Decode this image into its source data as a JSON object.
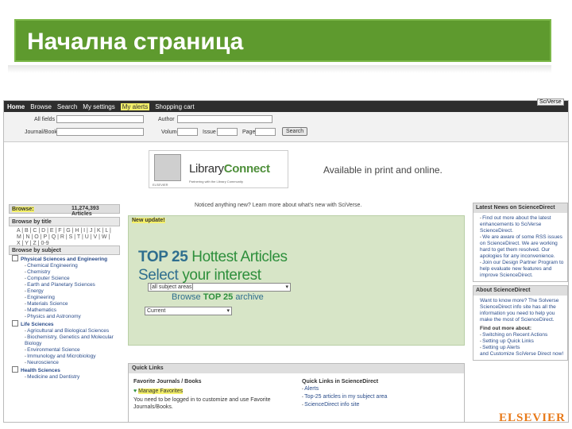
{
  "slide": {
    "title": "Начална страница"
  },
  "topnav": {
    "items": [
      "Home",
      "Browse",
      "Search",
      "My settings",
      "My alerts",
      "Shopping cart"
    ],
    "help": "Help"
  },
  "search": {
    "all_fields": "All fields",
    "journal_book_title": "Journal/Book title",
    "author": "Author",
    "volume": "Volume",
    "issue": "Issue",
    "page": "Page",
    "button": "Search"
  },
  "banner": {
    "brand_a": "Library",
    "brand_b": "Connect",
    "tagline": "Partnering with the Library Community",
    "elsevier": "ELSEVIER",
    "available": "Available in print and online."
  },
  "notice": "Noticed anything new? Learn more about what's new with SciVerse.",
  "left": {
    "browse_label": "Browse:",
    "browse_count": "11,274,393 Articles",
    "by_title": "Browse by title",
    "az": "A | B | C | D | E | F | G | H | I | J | K | L | M | N | O | P | Q | R | S | T | U | V | W | X | Y | Z | 0-9",
    "by_subject": "Browse by subject",
    "subjects": [
      {
        "cat": "Physical Sciences and Engineering",
        "items": [
          "Chemical Engineering",
          "Chemistry",
          "Computer Science",
          "Earth and Planetary Sciences",
          "Energy",
          "Engineering",
          "Materials Science",
          "Mathematics",
          "Physics and Astronomy"
        ]
      },
      {
        "cat": "Life Sciences",
        "items": [
          "Agricultural and Biological Sciences",
          "Biochemistry, Genetics and Molecular Biology",
          "Environmental Science",
          "Immunology and Microbiology",
          "Neuroscience"
        ]
      },
      {
        "cat": "Health Sciences",
        "items": [
          "Medicine and Dentistry"
        ]
      }
    ]
  },
  "center": {
    "new_update": "New update!",
    "top25_a": "TOP 25",
    "top25_b": "Hottest Articles",
    "select_a": "Select",
    "select_b": "your interest",
    "subject_select": "[all subject areas]",
    "browse_a": "Browse",
    "browse_b": "TOP 25",
    "browse_c": "archive",
    "period_select": "Current"
  },
  "quick": {
    "header": "Quick Links",
    "fav_title": "Favorite Journals / Books",
    "manage": "Manage Favorites",
    "login_note": "You need to be logged in to customize and use Favorite Journals/Books.",
    "ql_title": "Quick Links in ScienceDirect",
    "links": [
      "Alerts",
      "Top-25 articles in my subject area",
      "ScienceDirect info site"
    ]
  },
  "right": {
    "news_hdr": "Latest News on ScienceDirect",
    "news": [
      "Find out more about the latest enhancements to SciVerse ScienceDirect.",
      "We are aware of some RSS issues on ScienceDirect. We are working hard to get them resolved. Our apologies for any inconvenience.",
      "Join our Design Partner Program to help evaluate new features and improve ScienceDirect."
    ],
    "about_hdr": "About ScienceDirect",
    "about": "Want to know more? The Solverse ScienceDirect info site has all the information you need to help you make the most of ScienceDirect.",
    "find_hdr": "Find out more about:",
    "find": [
      "Switching on Recent Actions",
      "Setting up Quick Links",
      "Setting up Alerts",
      "and Customize SciVerse Direct now!"
    ]
  },
  "corner_logo": "SciVerse",
  "footer_brand": "ELSEVIER"
}
